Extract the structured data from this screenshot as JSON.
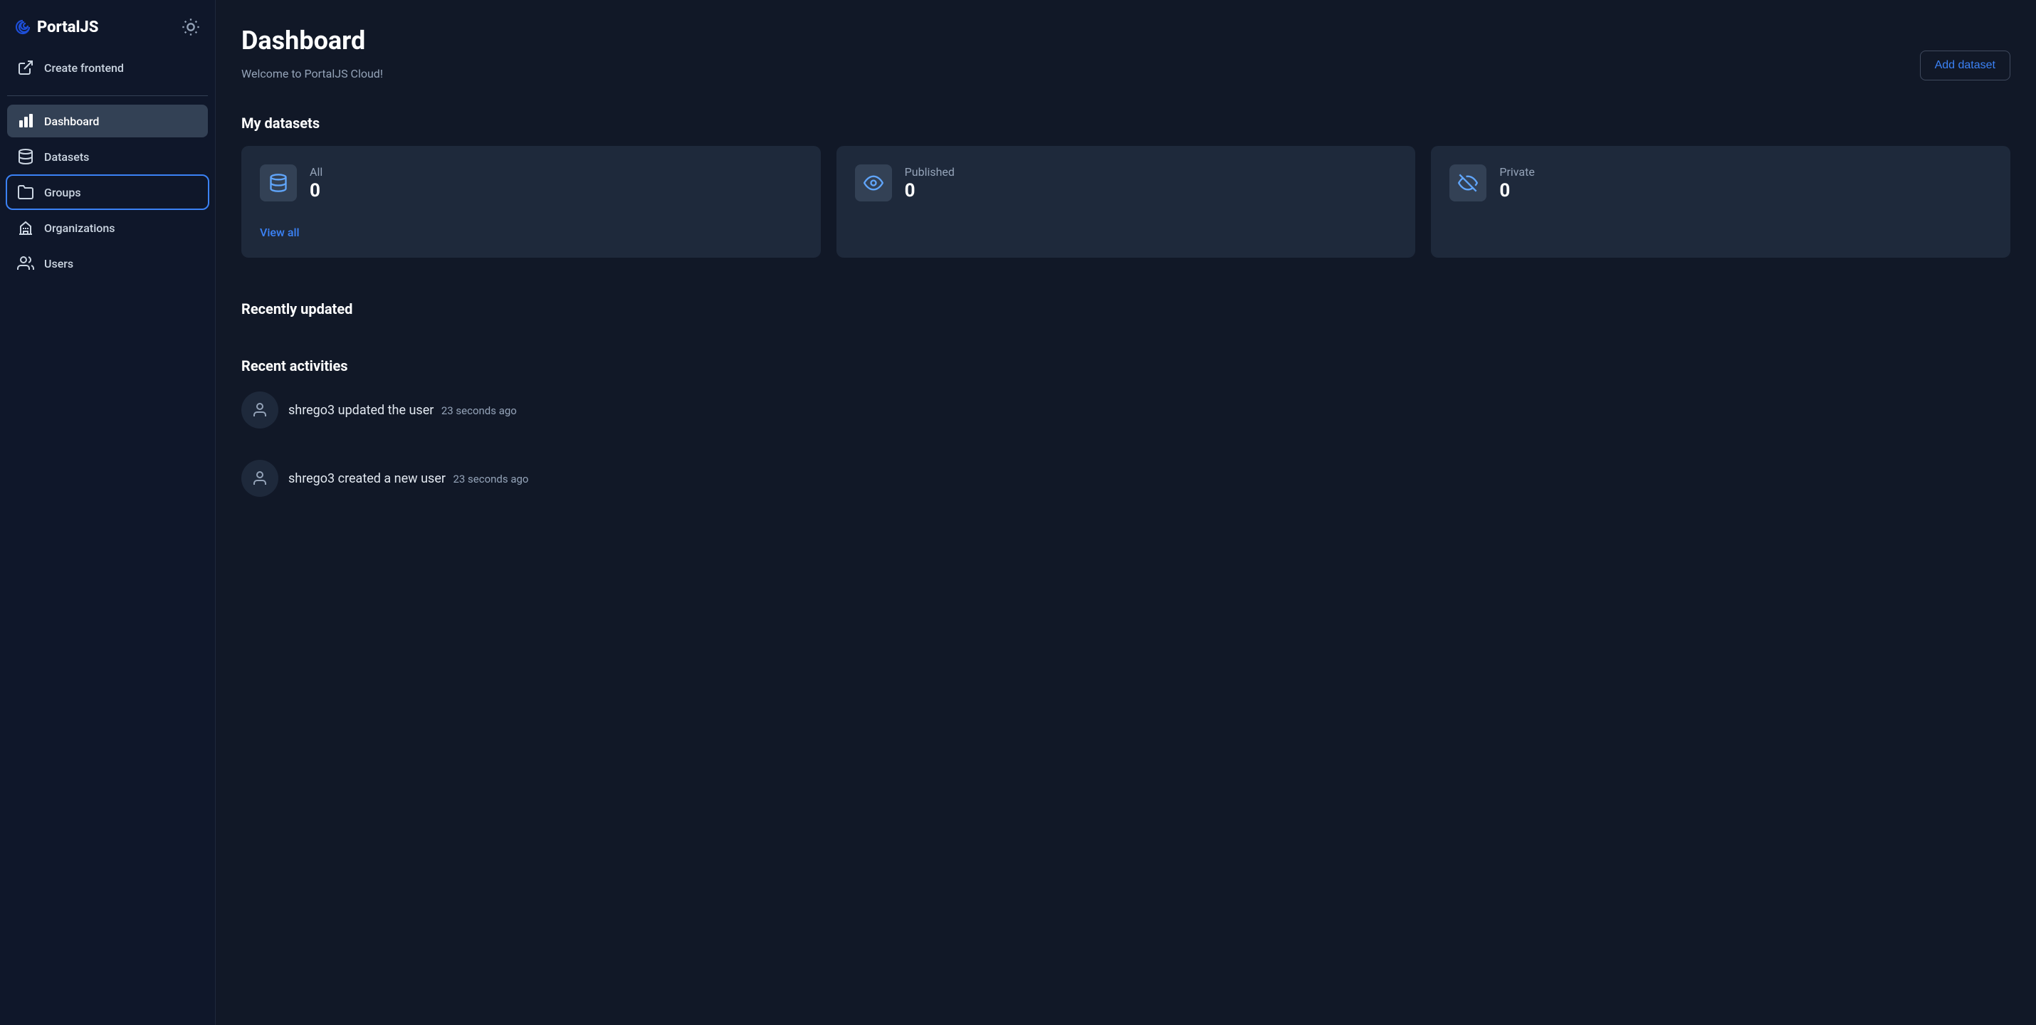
{
  "logo": {
    "text": "PortalJS"
  },
  "sidebar": {
    "create_frontend": "Create frontend",
    "items": [
      {
        "label": "Dashboard"
      },
      {
        "label": "Datasets"
      },
      {
        "label": "Groups"
      },
      {
        "label": "Organizations"
      },
      {
        "label": "Users"
      }
    ]
  },
  "header": {
    "title": "Dashboard",
    "subtitle": "Welcome to PortalJS Cloud!",
    "add_button": "Add dataset"
  },
  "sections": {
    "my_datasets": "My datasets",
    "recently_updated": "Recently updated",
    "recent_activities": "Recent activities"
  },
  "stats": {
    "all": {
      "label": "All",
      "value": "0",
      "link": "View all"
    },
    "published": {
      "label": "Published",
      "value": "0"
    },
    "private": {
      "label": "Private",
      "value": "0"
    }
  },
  "activities": [
    {
      "actor": "shrego3",
      "action": "updated the user",
      "time": "23 seconds ago"
    },
    {
      "actor": "shrego3",
      "action": "created a new user",
      "time": "23 seconds ago"
    }
  ]
}
